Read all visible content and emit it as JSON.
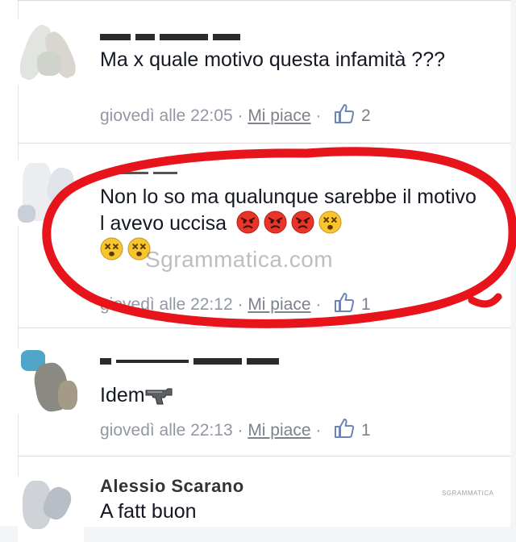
{
  "watermark": "Sgrammatica.com",
  "corner_mark": "SGRAMMATICA",
  "comments": [
    {
      "text": "Ma x quale motivo questa infamità ???",
      "time": "giovedì alle 22:05",
      "like_label": "Mi piace",
      "like_count": "2",
      "icons": [
        "thumbs-up-icon"
      ]
    },
    {
      "text": "Non lo so ma qualunque sarebbe il motivo l avevo uccisa",
      "emojis": [
        "angry-face-icon",
        "angry-face-icon",
        "angry-face-icon",
        "dizzy-face-icon",
        "dizzy-face-icon",
        "dizzy-face-icon"
      ],
      "time": "giovedì alle 22:12",
      "like_label": "Mi piace",
      "like_count": "1",
      "icons": [
        "thumbs-up-icon"
      ]
    },
    {
      "text": "Idem",
      "emojis": [
        "pistol-icon"
      ],
      "time": "giovedì alle 22:13",
      "like_label": "Mi piace",
      "like_count": "1",
      "icons": [
        "thumbs-up-icon"
      ]
    },
    {
      "author": "Alessio Scarano",
      "text": "A fatt buon"
    }
  ],
  "colors": {
    "highlight_circle": "#e8141c",
    "meta_text": "#9197a3",
    "body_text": "#141823"
  }
}
